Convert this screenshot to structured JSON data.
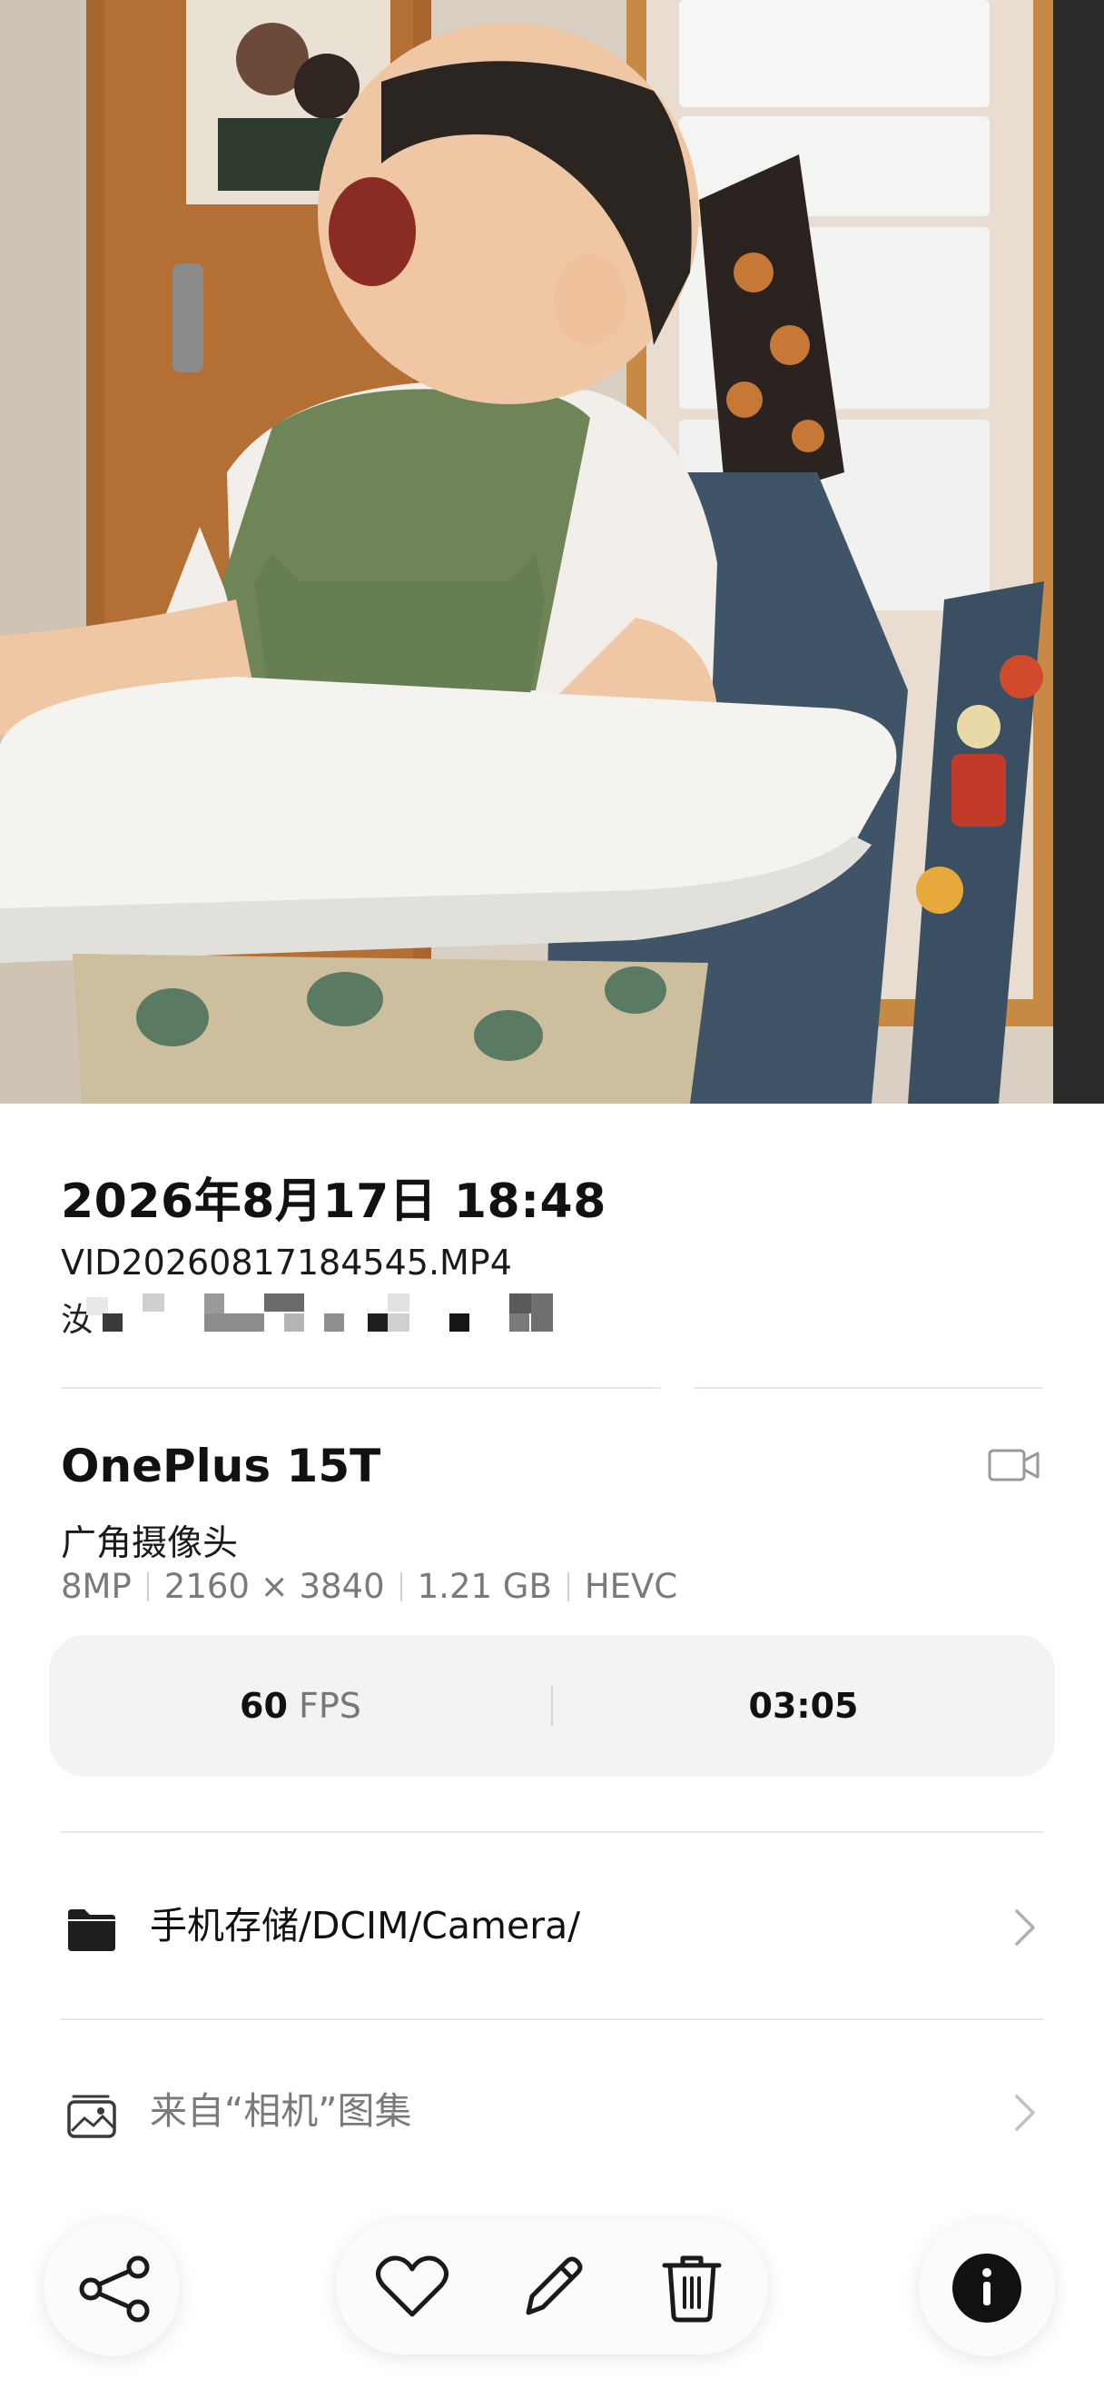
{
  "details": {
    "date_time": "2026年8月17日 18:48",
    "filename": "VID20260817184545.MP4",
    "masked_text_prefix": "汝"
  },
  "device": {
    "model": "OnePlus 15T",
    "lens": "广角摄像头",
    "specs": [
      "8MP",
      "2160 × 3840",
      "1.21 GB",
      "HEVC"
    ],
    "media_type_icon": "video-camera-icon"
  },
  "stats": {
    "fps_value": "60",
    "fps_unit": "FPS",
    "duration": "03:05"
  },
  "location": {
    "path": "手机存储/DCIM/Camera/",
    "icon": "folder-icon"
  },
  "album": {
    "label": "来自“相机”图集",
    "icon": "album-icon"
  },
  "toolbar": {
    "share_icon": "share-icon",
    "favorite_icon": "heart-icon",
    "edit_icon": "pencil-icon",
    "delete_icon": "trash-icon",
    "info_icon": "info-icon"
  },
  "colors": {
    "background": "#ffffff",
    "stats_card": "#f3f3f3",
    "secondary_text": "#7a7a7a",
    "info_button_fill": "#111111"
  }
}
